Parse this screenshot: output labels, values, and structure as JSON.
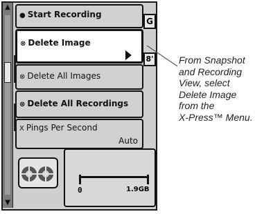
{
  "menu": {
    "items": [
      {
        "glyph": "●",
        "label": "Start Recording"
      },
      {
        "glyph": "⊗",
        "label": "Delete Image"
      },
      {
        "glyph": "⊗",
        "label": "Delete All Images"
      },
      {
        "glyph": "⊗",
        "label": "Delete All Recordings"
      },
      {
        "glyph": "X",
        "label": "Pings Per Second",
        "value": "Auto"
      }
    ],
    "selected_index": 1
  },
  "background": {
    "fragment_top_right": "G",
    "fragment_mid_right": "8'",
    "memory_used_label": "0",
    "memory_total_label": "1.9GB"
  },
  "icons": {
    "selected_arrow": "play-arrow-icon",
    "scroll_up": "scroll-up-icon",
    "scroll_down": "scroll-down-icon",
    "sonar": "sonar-fish-icon"
  },
  "caption": {
    "lines": [
      "From Snapshot",
      "and Recording",
      "View, select",
      "Delete Image",
      "from the",
      "X-Press™ Menu."
    ]
  }
}
